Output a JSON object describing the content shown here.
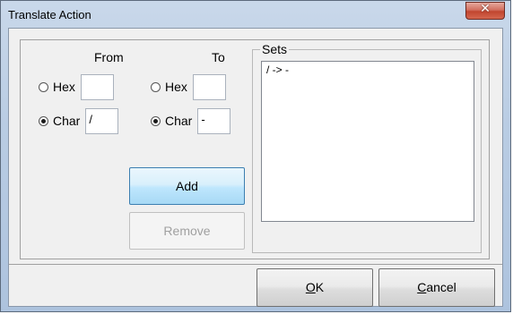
{
  "window": {
    "title": "Translate Action",
    "close_symbol": "✕"
  },
  "from": {
    "header": "From",
    "hex_label": "Hex",
    "hex_value": "",
    "char_label": "Char",
    "char_value": "/",
    "selected": "char"
  },
  "to": {
    "header": "To",
    "hex_label": "Hex",
    "hex_value": "",
    "char_label": "Char",
    "char_value": "-",
    "selected": "char"
  },
  "buttons": {
    "add": "Add",
    "remove": "Remove",
    "ok_rest": "K",
    "ok_mnemonic": "O",
    "cancel_mnemonic": "C",
    "cancel_rest": "ancel"
  },
  "sets": {
    "title": "Sets",
    "items": [
      "/ -> -"
    ]
  }
}
